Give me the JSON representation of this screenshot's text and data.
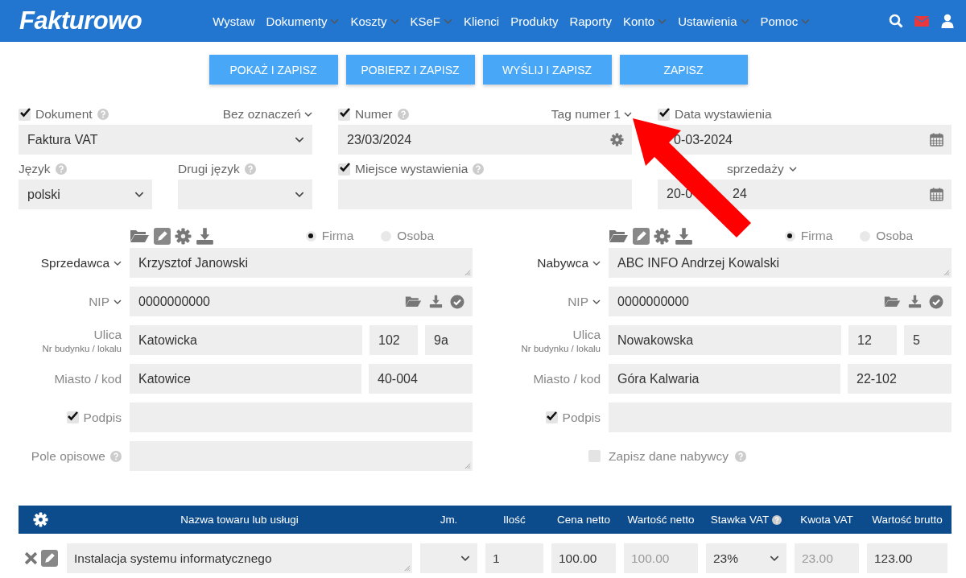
{
  "header": {
    "logo": "Fakturowo",
    "nav": [
      {
        "label": "Wystaw",
        "dropdown": false
      },
      {
        "label": "Dokumenty",
        "dropdown": true
      },
      {
        "label": "Koszty",
        "dropdown": true
      },
      {
        "label": "KSeF",
        "dropdown": true
      },
      {
        "label": "Klienci",
        "dropdown": false
      },
      {
        "label": "Produkty",
        "dropdown": false
      },
      {
        "label": "Raporty",
        "dropdown": false
      },
      {
        "label": "Konto",
        "dropdown": true
      },
      {
        "label": "Ustawienia",
        "dropdown": true
      },
      {
        "label": "Pomoc",
        "dropdown": true
      }
    ]
  },
  "actions": [
    "POKAŻ I ZAPISZ",
    "POBIERZ I ZAPISZ",
    "WYŚLIJ I ZAPISZ",
    "ZAPISZ"
  ],
  "document": {
    "checked": true,
    "label": "Dokument",
    "help": true,
    "marking": "Bez oznaczeń",
    "value": "Faktura VAT"
  },
  "number": {
    "checked": true,
    "label": "Numer",
    "help": true,
    "tag": "Tag numer 1",
    "value": "23/03/2024"
  },
  "issue_date": {
    "checked": true,
    "label": "Data wystawienia",
    "value": "0-03-2024"
  },
  "language": {
    "label": "Język",
    "help": true,
    "value": "polski"
  },
  "second_language": {
    "label": "Drugi język",
    "help": true
  },
  "place": {
    "checked": true,
    "label": "Miejsce wystawienia",
    "help": true
  },
  "sale_date": {
    "label": "sprzedaży",
    "value_parts": [
      "20-0",
      "24"
    ]
  },
  "parties": [
    {
      "role": "Sprzedawca",
      "types": [
        {
          "label": "Firma",
          "selected": true
        },
        {
          "label": "Osoba",
          "selected": false
        }
      ],
      "name": "Krzysztof Janowski",
      "nip_label": "NIP",
      "nip": "0000000000",
      "street_label": "Ulica",
      "street_sublabel": "Nr budynku / lokalu",
      "street": "Katowicka",
      "building": "102",
      "unit": "9a",
      "city_label": "Miasto / kod",
      "city": "Katowice",
      "postal": "40-004",
      "signature": {
        "label": "Podpis",
        "checked": true
      },
      "extra": {
        "kind": "description",
        "label": "Pole opisowe",
        "help": true
      }
    },
    {
      "role": "Nabywca",
      "types": [
        {
          "label": "Firma",
          "selected": true
        },
        {
          "label": "Osoba",
          "selected": false
        }
      ],
      "name": "ABC INFO Andrzej Kowalski",
      "nip_label": "NIP",
      "nip": "0000000000",
      "street_label": "Ulica",
      "street_sublabel": "Nr budynku / lokalu",
      "street": "Nowakowska",
      "building": "12",
      "unit": "5",
      "city_label": "Miasto / kod",
      "city": "Góra Kalwaria",
      "postal": "22-102",
      "signature": {
        "label": "Podpis",
        "checked": true
      },
      "extra": {
        "kind": "save",
        "label": "Zapisz dane nabywcy",
        "help": true,
        "checked": false
      }
    }
  ],
  "items_table": {
    "columns": [
      {
        "label": "Nazwa towaru lub usługi",
        "help": false
      },
      {
        "label": "Jm.",
        "help": false
      },
      {
        "label": "Ilość",
        "help": false
      },
      {
        "label": "Cena netto",
        "help": false
      },
      {
        "label": "Wartość netto",
        "help": false
      },
      {
        "label": "Stawka VAT",
        "help": true
      },
      {
        "label": "Kwota VAT",
        "help": false
      },
      {
        "label": "Wartość brutto",
        "help": false
      }
    ],
    "rows": [
      {
        "cells": [
          {
            "kind": "textarea",
            "value": "Instalacja systemu informatycznego"
          },
          {
            "kind": "select"
          },
          {
            "kind": "input",
            "value": "1"
          },
          {
            "kind": "input",
            "value": "100.00"
          },
          {
            "kind": "readonly",
            "value": "100.00"
          },
          {
            "kind": "select",
            "value": "23%"
          },
          {
            "kind": "readonly",
            "value": "23.00"
          },
          {
            "kind": "input",
            "value": "123.00"
          }
        ]
      }
    ]
  }
}
